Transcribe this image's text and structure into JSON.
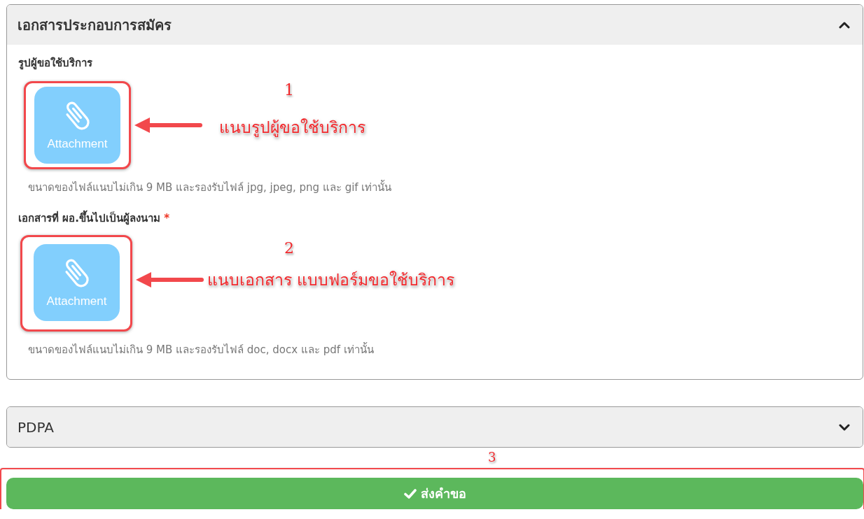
{
  "sections": [
    {
      "title": "เอกสารประกอบการสมัคร",
      "expanded": true,
      "fields": [
        {
          "label": "รูปผู้ขอใช้บริการ",
          "button_label": "Attachment",
          "hint": "ขนาดของไฟล์แนบไม่เกิน 9 MB และรองรับไฟล์ jpg, jpeg, png และ gif เท่านั้น",
          "annotation": {
            "number": "1",
            "text": "แนบรูปผู้ขอใช้บริการ"
          }
        },
        {
          "label": "เอกสารที่ ผอ.ขึ้นไปเป็นผู้ลงนาม",
          "required_mark": "*",
          "button_label": "Attachment",
          "hint": "ขนาดของไฟล์แนบไม่เกิน 9 MB และรองรับไฟล์ doc, docx และ pdf เท่านั้น",
          "annotation": {
            "number": "2",
            "text": "แนบเอกสาร แบบฟอร์มขอใช้บริการ"
          }
        }
      ]
    },
    {
      "title": "PDPA",
      "expanded": false
    }
  ],
  "submit_button": {
    "label": "ส่งคำขอ",
    "annotation": {
      "number": "3"
    }
  }
}
